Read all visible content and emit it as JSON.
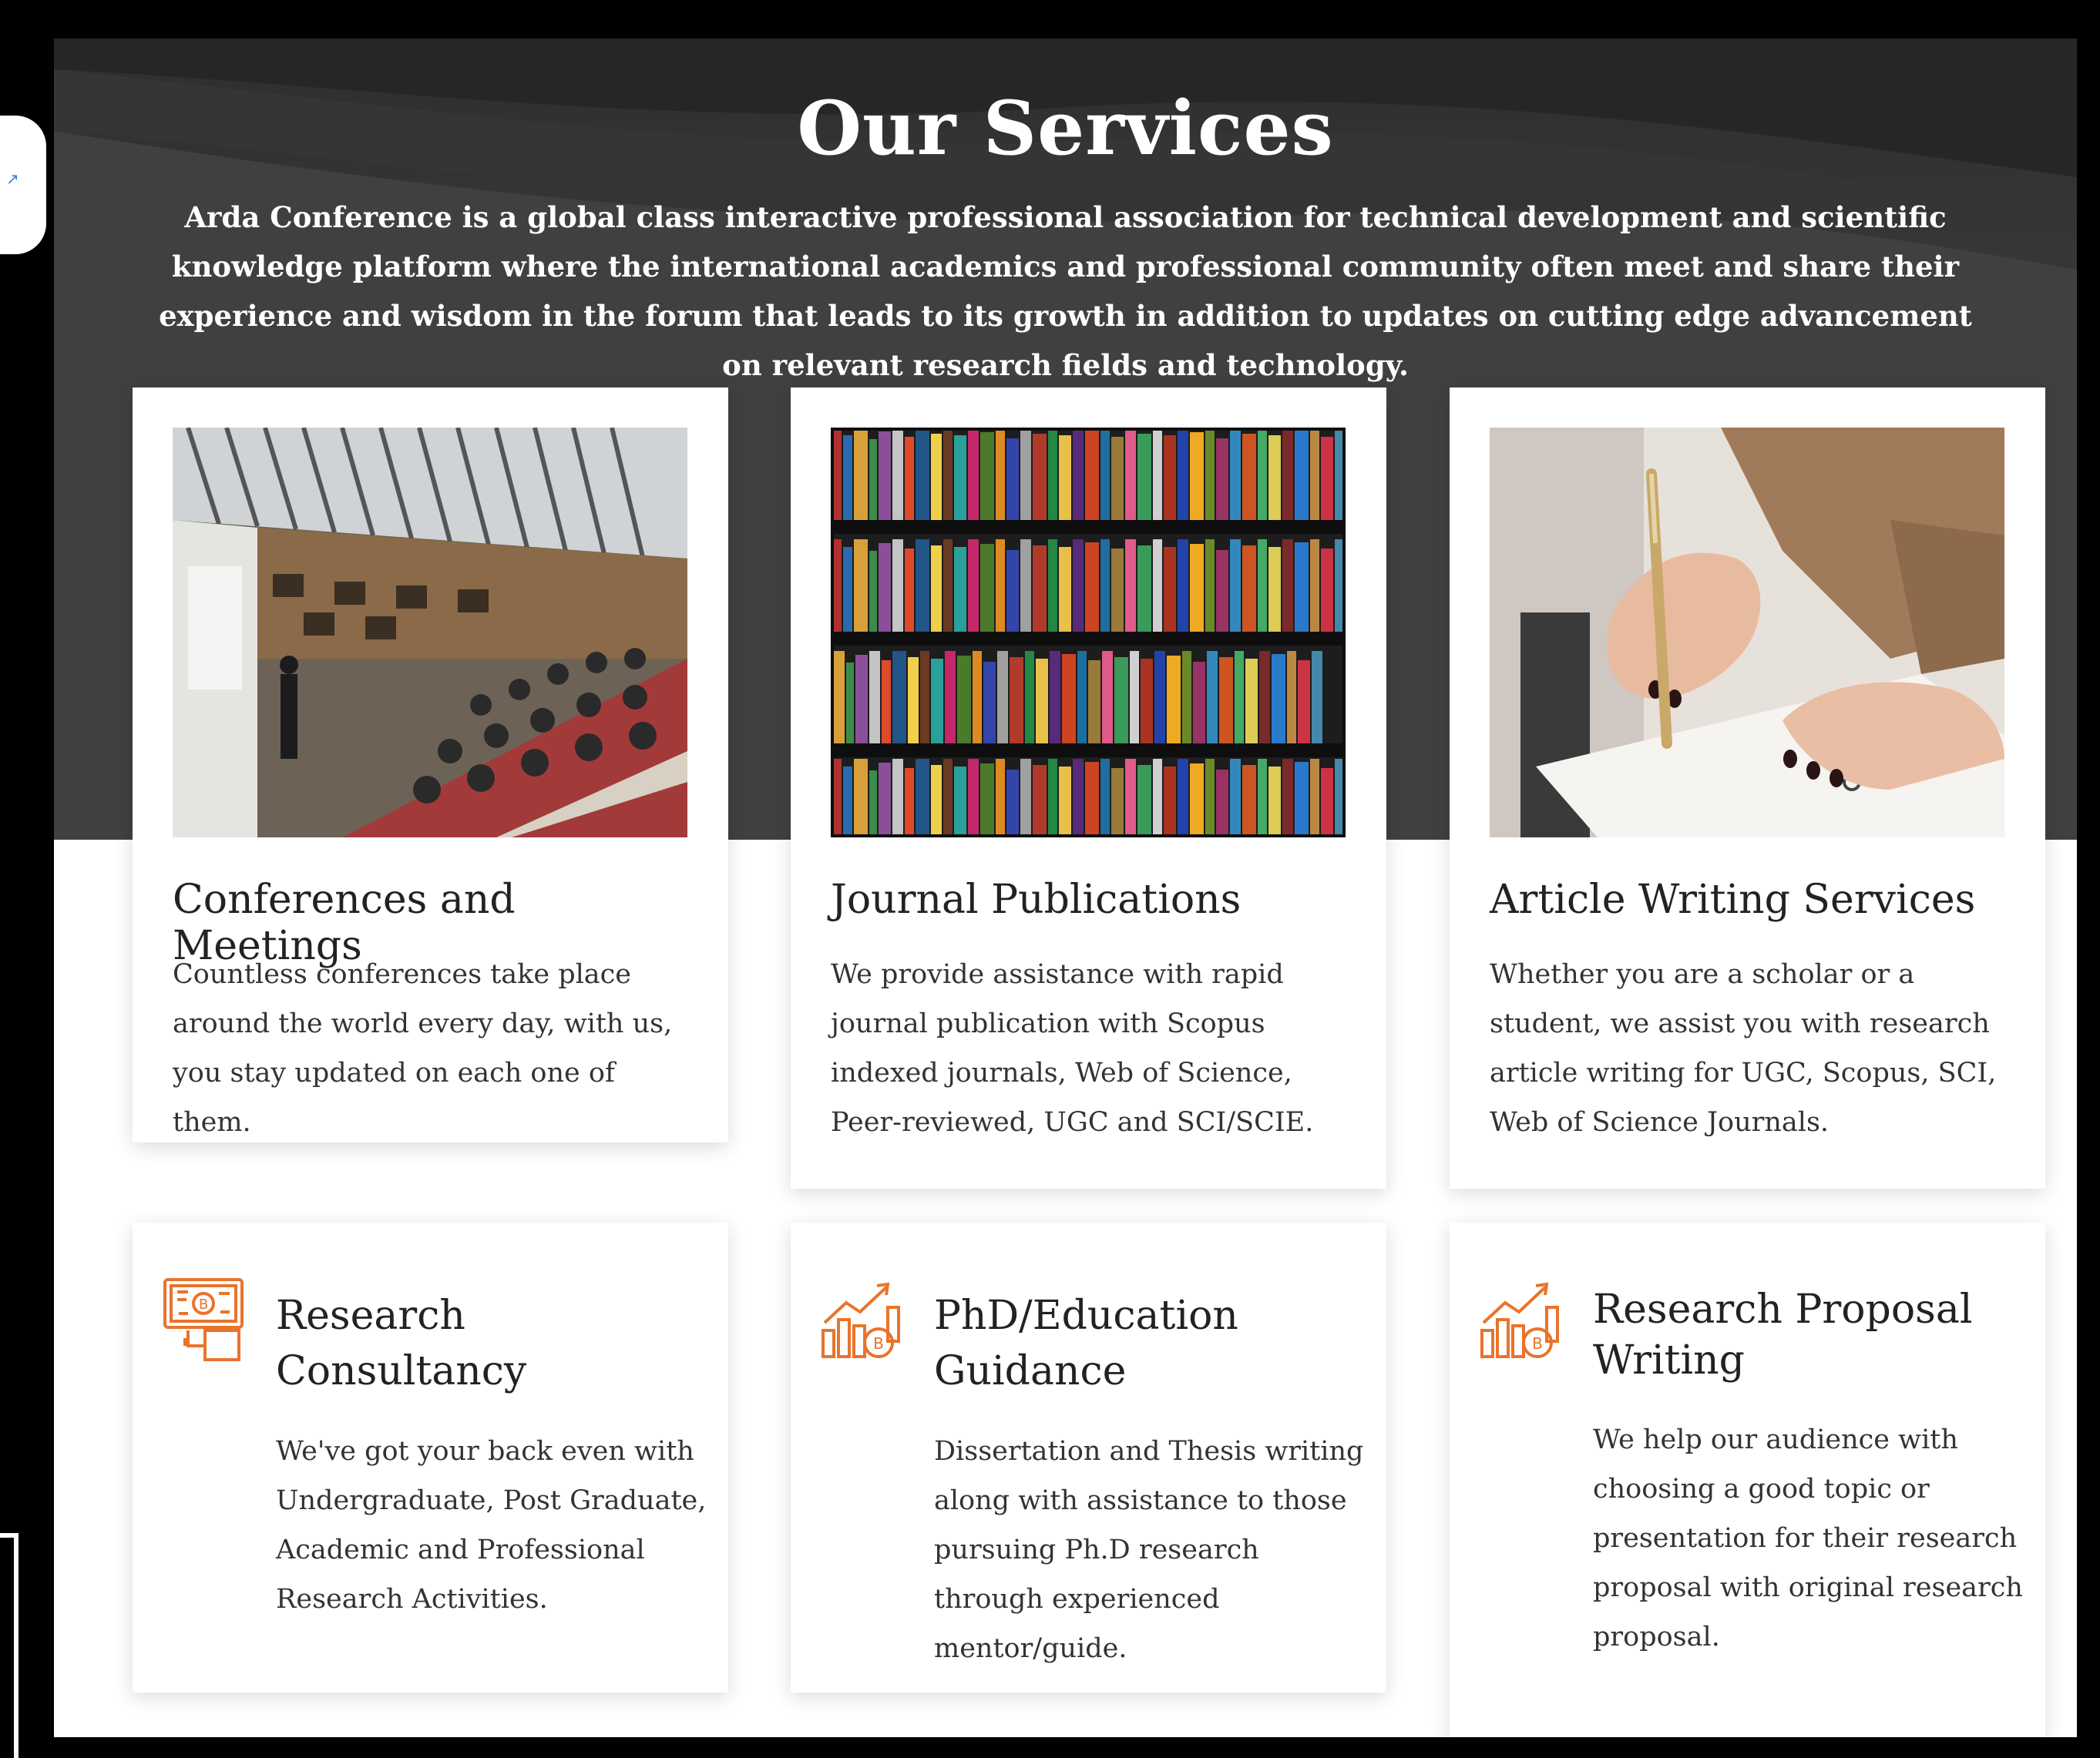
{
  "header": {
    "title": "Our Services",
    "intro": "Arda Conference is a global class interactive professional association for technical development and scientific knowledge platform where the international academics and professional community often meet and share their experience and wisdom in the forum that leads to its growth in addition to updates on cutting edge advancement on relevant research fields and technology."
  },
  "services_top": [
    {
      "title": "Conferences and Meetings",
      "description": "Countless conferences take place around the world every day, with us, you stay updated on each one of them.",
      "image_icon": "lecture-hall-photo"
    },
    {
      "title": "Journal Publications",
      "description": "We provide assistance with rapid journal publication with Scopus indexed journals, Web of Science, Peer-reviewed, UGC and SCI/SCIE.",
      "image_icon": "bookshelf-photo"
    },
    {
      "title": "Article Writing Services",
      "description": "Whether you are a scholar or a student, we assist you with research article writing for UGC, Scopus, SCI, Web of Science Journals.",
      "image_icon": "writing-hand-photo"
    }
  ],
  "services_bottom": [
    {
      "title": "Research Consultancy",
      "description": "We've got your back even with Undergraduate, Post Graduate, Academic and Professional Research Activities.",
      "icon": "circuit-board-icon"
    },
    {
      "title": "PhD/Education Guidance",
      "description": "Dissertation and Thesis writing along with assistance to those pursuing Ph.D research through experienced mentor/guide.",
      "icon": "growth-chart-icon"
    },
    {
      "title": "Research Proposal Writing",
      "description": "We help our audience with choosing a good topic or presentation for their research proposal with original research proposal.",
      "icon": "growth-chart-icon"
    }
  ],
  "colors": {
    "accent": "#e8742c",
    "hero_bg": "#3a3a3a",
    "text": "#222222"
  }
}
